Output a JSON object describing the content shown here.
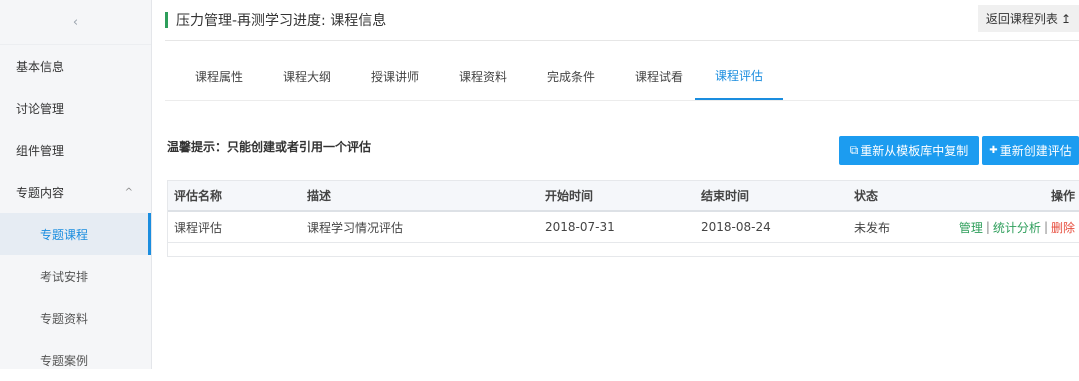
{
  "sidebar": {
    "collapse_glyph": "‹",
    "items": [
      {
        "label": "基本信息"
      },
      {
        "label": "讨论管理"
      },
      {
        "label": "组件管理"
      },
      {
        "label": "专题内容",
        "chevron": "^"
      },
      {
        "label": "专题课程"
      },
      {
        "label": "考试安排"
      },
      {
        "label": "专题资料"
      },
      {
        "label": "专题案例"
      }
    ]
  },
  "header": {
    "title": "压力管理-再测学习进度: 课程信息",
    "back_label": "返回课程列表",
    "back_glyph": "↥"
  },
  "tabs": [
    {
      "label": "课程属性"
    },
    {
      "label": "课程大纲"
    },
    {
      "label": "授课讲师"
    },
    {
      "label": "课程资料"
    },
    {
      "label": "完成条件"
    },
    {
      "label": "课程试看"
    },
    {
      "label": "课程评估"
    }
  ],
  "tip": "温馨提示：只能创建或者引用一个评估",
  "buttons": {
    "copy_label": "重新从模板库中复制",
    "copy_icon": "⧉",
    "create_label": "重新创建评估",
    "create_icon": "✚"
  },
  "table": {
    "headers": [
      "评估名称",
      "描述",
      "开始时间",
      "结束时间",
      "状态",
      "操作"
    ],
    "rows": [
      {
        "name": "课程评估",
        "desc": "课程学习情况评估",
        "start": "2018-07-31",
        "end": "2018-08-24",
        "status": "未发布",
        "actions": {
          "manage": "管理",
          "stats": "统计分析",
          "delete": "删除",
          "sep": "|"
        }
      }
    ]
  },
  "colors": {
    "accent": "#1a8ddf",
    "primary_button": "#1c9cf0",
    "success": "#2e9e5b",
    "danger": "#e74c3c"
  }
}
